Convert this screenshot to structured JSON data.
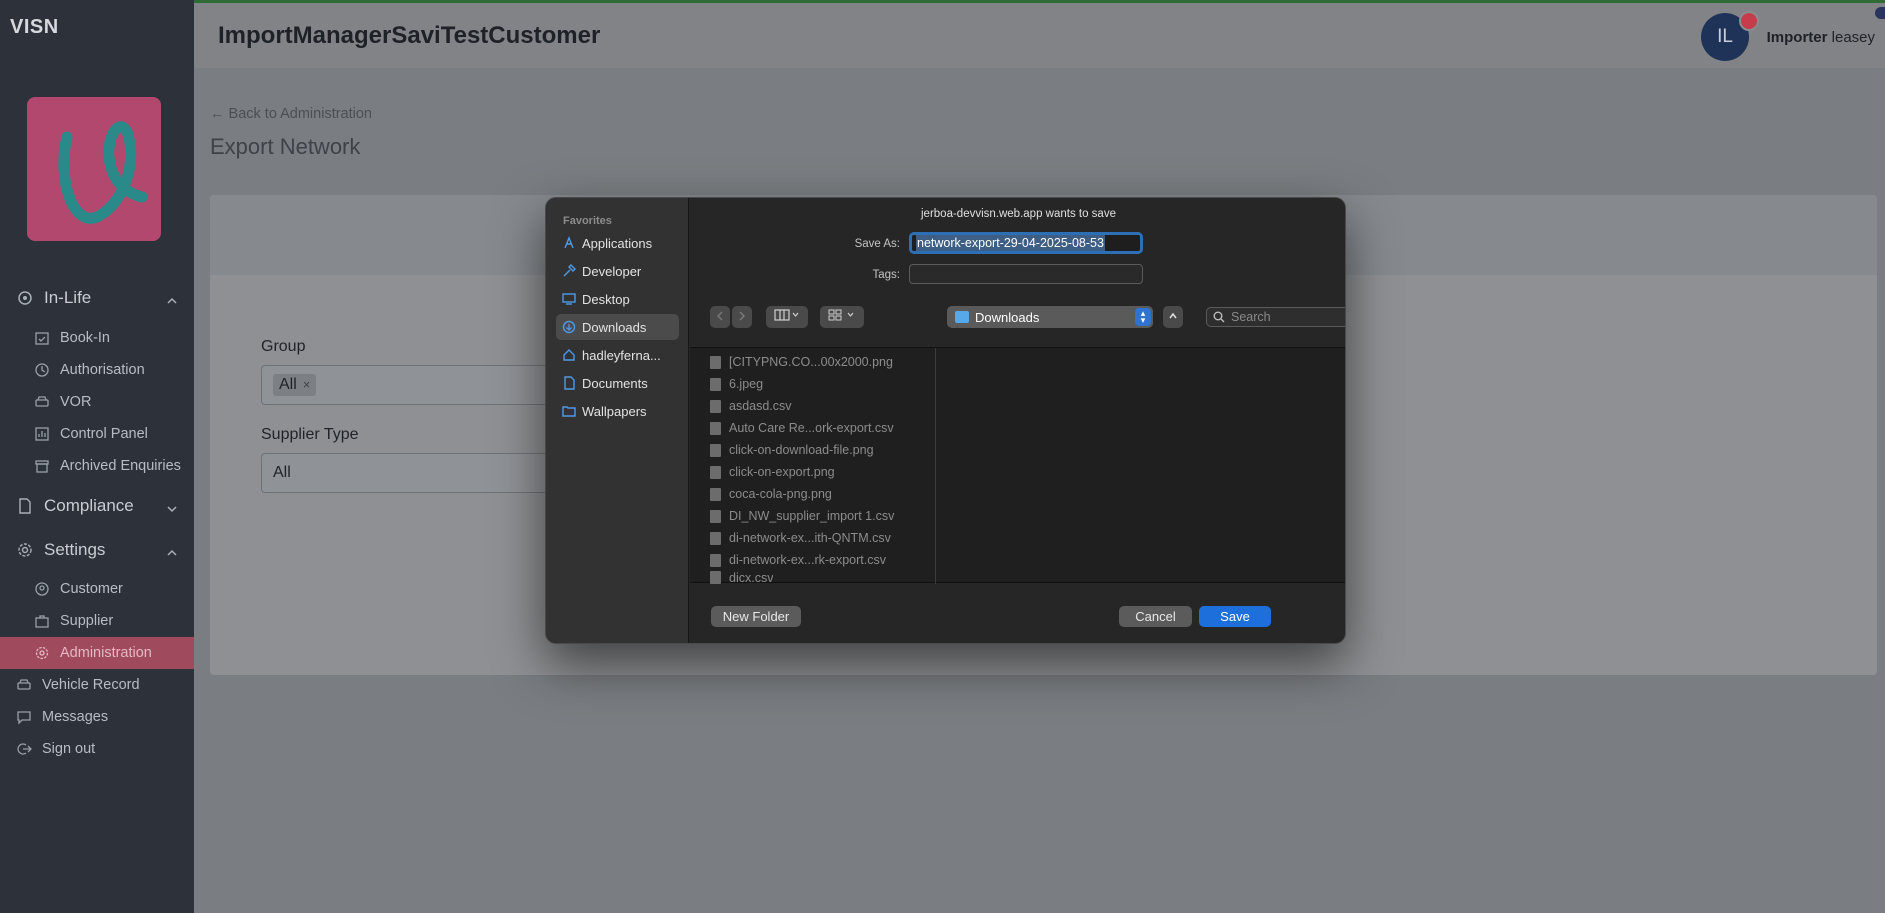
{
  "sidebar": {
    "brand": "VISN",
    "sections": {
      "inlife": "In-Life",
      "compliance": "Compliance",
      "settings": "Settings"
    },
    "inlife_items": [
      "Book-In",
      "Authorisation",
      "VOR",
      "Control Panel",
      "Archived Enquiries"
    ],
    "settings_items": [
      "Customer",
      "Supplier",
      "Administration"
    ],
    "bottom_items": [
      "Vehicle Record",
      "Messages",
      "Sign out"
    ]
  },
  "header": {
    "title": "ImportManagerSaviTestCustomer",
    "avatar_initials": "IL",
    "user_first": "Importer",
    "user_last": "leasey"
  },
  "main": {
    "back_link": "Back to Administration",
    "page_title": "Export Network",
    "group_label": "Group",
    "group_chip": "All",
    "supplier_type_label": "Supplier Type",
    "supplier_type_value": "All"
  },
  "dialog": {
    "title": "jerboa-devvisn.web.app wants to save",
    "save_as_label": "Save As:",
    "save_as_value": "network-export-29-04-2025-08-53",
    "tags_label": "Tags:",
    "location": "Downloads",
    "search_placeholder": "Search",
    "favorites_heading": "Favorites",
    "favorites": [
      "Applications",
      "Developer",
      "Desktop",
      "Downloads",
      "hadleyferna...",
      "Documents",
      "Wallpapers"
    ],
    "files": [
      "[CITYPNG.CO...00x2000.png",
      "6.jpeg",
      "asdasd.csv",
      "Auto Care Re...ork-export.csv",
      "click-on-download-file.png",
      "click-on-export.png",
      "coca-cola-png.png",
      "DI_NW_supplier_import 1.csv",
      "di-network-ex...ith-QNTM.csv",
      "di-network-ex...rk-export.csv",
      "dicx.csv"
    ],
    "new_folder": "New Folder",
    "cancel": "Cancel",
    "save": "Save"
  }
}
